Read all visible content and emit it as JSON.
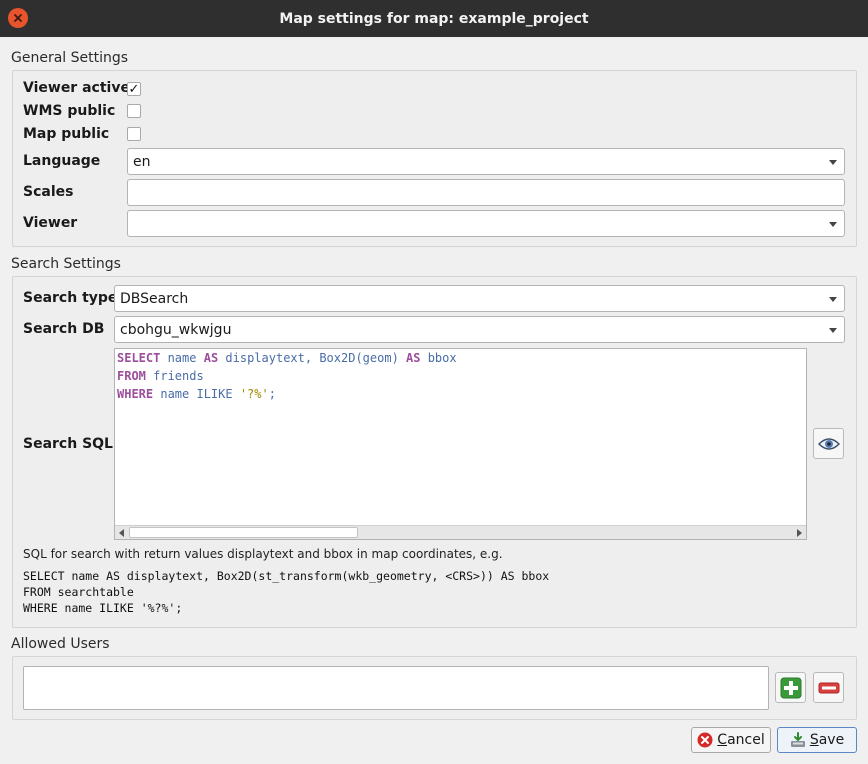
{
  "window": {
    "title": "Map settings for map: example_project"
  },
  "general": {
    "title": "General Settings",
    "viewer_active_label": "Viewer active",
    "viewer_active_checked": true,
    "wms_public_label": "WMS public",
    "wms_public_checked": false,
    "map_public_label": "Map public",
    "map_public_checked": false,
    "language_label": "Language",
    "language_value": "en",
    "scales_label": "Scales",
    "scales_value": "",
    "viewer_label": "Viewer",
    "viewer_value": ""
  },
  "search": {
    "title": "Search Settings",
    "type_label": "Search type",
    "type_value": "DBSearch",
    "db_label": "Search DB",
    "db_value": "cbohgu_wkwjgu",
    "sql_label": "Search SQL",
    "sql_lines": [
      "SELECT name AS displaytext, Box2D(geom) AS bbox",
      "FROM friends",
      "WHERE name ILIKE '?%';"
    ],
    "hint": "SQL for search with return values displaytext and bbox in map coordinates, e.g.",
    "example_lines": [
      "SELECT name AS displaytext, Box2D(st_transform(wkb_geometry, <CRS>)) AS bbox",
      "FROM searchtable",
      "WHERE name ILIKE '%?%';"
    ]
  },
  "users": {
    "title": "Allowed Users"
  },
  "buttons": {
    "cancel_mnemonic": "C",
    "cancel_rest": "ancel",
    "save_mnemonic": "S",
    "save_rest": "ave"
  },
  "icons": {
    "close": "close-icon",
    "preview": "eye-icon",
    "add": "plus-icon",
    "remove": "minus-icon",
    "cancel": "cancel-icon",
    "save": "save-icon"
  },
  "colors": {
    "titlebar": "#2f2f2f",
    "close": "#e8542c",
    "sql_keyword": "#9c4f9c",
    "sql_identifier": "#4a6da7",
    "sql_string": "#9a8b00",
    "add_green": "#3a9a3a",
    "remove_red": "#d94040"
  }
}
